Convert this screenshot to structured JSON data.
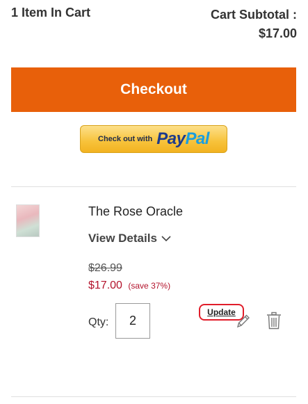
{
  "cart_summary": {
    "item_count_label": "1 Item In Cart",
    "subtotal_label": "Cart Subtotal :",
    "subtotal_value": "$17.00"
  },
  "checkout": {
    "button_label": "Checkout",
    "paypal_text": "Check out with",
    "paypal_logo_part1": "Pay",
    "paypal_logo_part2": "Pal"
  },
  "item": {
    "name": "The Rose Oracle",
    "view_details_label": "View Details",
    "original_price": "$26.99",
    "sale_price": "$17.00",
    "save_note": "(save 37%)",
    "qty_label": "Qty:",
    "qty_value": "2",
    "update_label": "Update"
  },
  "icons": {
    "chevron": "chevron-down-icon",
    "edit": "pencil-icon",
    "delete": "trash-icon"
  },
  "colors": {
    "checkout_bg": "#e8600a",
    "sale_price": "#b3122b",
    "update_highlight": "#e11d2a"
  }
}
